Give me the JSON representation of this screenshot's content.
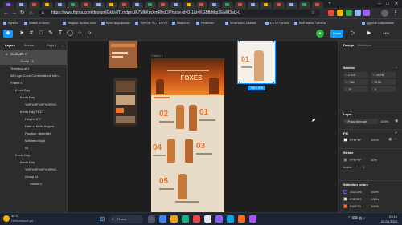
{
  "browser": {
    "url": "https://www.figma.com/design/jGkUv7f1mdpnUK7WkKmXmRfrdD/?node-id=0-1&t=KGBfbMtp2EwM3aQ-0",
    "bookmarks": [
      "Купить",
      "Watch in store",
      "Яндекс Читать книг",
      "Кухо Вкусфиско",
      "ТАРОВ ПО ТИТУЛ",
      "Новости",
      "Pinterest",
      "Усталость Lassell",
      "ЕКТП Читать",
      "Всё книги. Читать",
      "Другие избранные"
    ]
  },
  "toolbar": {
    "share_label": "Share",
    "zoom_label": "14%"
  },
  "left_panel": {
    "tabs": {
      "layers": "Layers",
      "assets": "Assets",
      "page": "Page 1"
    },
    "layers": [
      {
        "label": "Section 1",
        "indent": 0,
        "highlight": true
      },
      {
        "label": "Group 13",
        "indent": 2,
        "highlight": true
      },
      {
        "label": "Trending.ai 1",
        "indent": 0,
        "highlight": false
      },
      {
        "label": "58 Logo Color Combinations to In...",
        "indent": 0,
        "highlight": false
      },
      {
        "label": "Frame 1",
        "indent": 0,
        "highlight": false
      },
      {
        "label": "Kevin Day",
        "indent": 1,
        "highlight": false
      },
      {
        "label": "Kevin Day",
        "indent": 2,
        "highlight": false
      },
      {
        "label": "%3F%3F%3F%3F%3...",
        "indent": 3,
        "highlight": false
      },
      {
        "label": "Kevin Day TEXT",
        "indent": 2,
        "highlight": false
      },
      {
        "label": "Height: 6'0\"",
        "indent": 3,
        "highlight": false
      },
      {
        "label": "Date of birth: August...",
        "indent": 3,
        "highlight": false
      },
      {
        "label": "Position: defender",
        "indent": 3,
        "highlight": false
      },
      {
        "label": "Matthew Boyd",
        "indent": 3,
        "highlight": false
      },
      {
        "label": "01",
        "indent": 3,
        "highlight": false
      },
      {
        "label": "Kevin Day",
        "indent": 1,
        "highlight": false
      },
      {
        "label": "Kevin Day",
        "indent": 2,
        "highlight": false
      },
      {
        "label": "%3F%3F%3F%3F%3...",
        "indent": 3,
        "highlight": false
      },
      {
        "label": "Group 11",
        "indent": 3,
        "highlight": false
      },
      {
        "label": "Vector 3",
        "indent": 4,
        "highlight": false
      }
    ]
  },
  "canvas": {
    "frame_label": "Frame 1",
    "headline": "FOXES",
    "numbers": [
      "02",
      "01",
      "04",
      "03",
      "05"
    ],
    "selection_badge": "739 × 978"
  },
  "right_panel": {
    "tabs": {
      "design": "Design",
      "prototype": "Prototype"
    },
    "section_label": "Section",
    "x": "1703",
    "y": "-1676",
    "w": "788",
    "h": "978",
    "rotation": "0°",
    "radius": "0",
    "layer_label": "Layer",
    "blend": "Pass through",
    "blend_opacity": "100%",
    "fill_label": "Fill",
    "fill_hex": "FFFFFF",
    "fill_opacity": "100%",
    "stroke_label": "Stroke",
    "stroke_hex": "FFFFFF",
    "stroke_opacity": "10%",
    "stroke_pos": "Inside",
    "stroke_width": "1",
    "selcolors_label": "Selection colors",
    "selcolors": [
      {
        "hex": "2D2C96",
        "opacity": "100%",
        "color": "#2d2c96"
      },
      {
        "hex": "E3E3E3",
        "opacity": "100%",
        "color": "#e3e3e3"
      },
      {
        "hex": "F66F20",
        "opacity": "100%",
        "color": "#f66f20"
      }
    ]
  },
  "taskbar": {
    "weather": "11°C",
    "weather_sub": "Небольшой до...",
    "search_placeholder": "Поиск",
    "time": "23:16",
    "date": "22.06.2024"
  },
  "colors": {
    "accent": "#0d99ff",
    "brand_orange": "#f66f20",
    "poster_bg": "#e8dcc8"
  }
}
